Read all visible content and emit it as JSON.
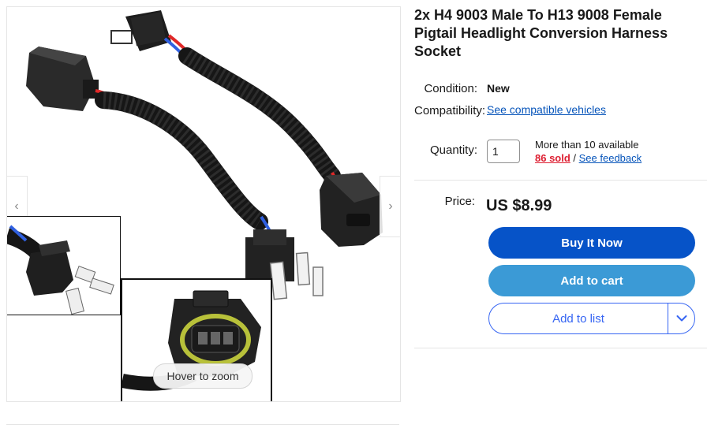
{
  "gallery": {
    "prev_glyph": "‹",
    "next_glyph": "›",
    "zoom_hint": "Hover to zoom"
  },
  "listing": {
    "title": "2x H4 9003 Male To H13 9008 Female Pigtail Headlight Conversion Harness Socket",
    "condition_label": "Condition:",
    "condition_value": "New",
    "compat_label": "Compatibility:",
    "compat_link": "See compatible vehicles",
    "quantity_label": "Quantity:",
    "quantity_value": "1",
    "availability": "More than 10 available",
    "sold_count": "86 sold",
    "sold_separator": " / ",
    "feedback_link": "See feedback",
    "price_label": "Price:",
    "price_value": "US $8.99"
  },
  "actions": {
    "buy_now": "Buy It Now",
    "add_to_cart": "Add to cart",
    "add_to_list": "Add to list"
  },
  "colors": {
    "buy_now_bg": "#0653c8",
    "add_to_cart_bg": "#3b9ad6",
    "link": "#0654ba",
    "sold": "#dd1e31"
  }
}
